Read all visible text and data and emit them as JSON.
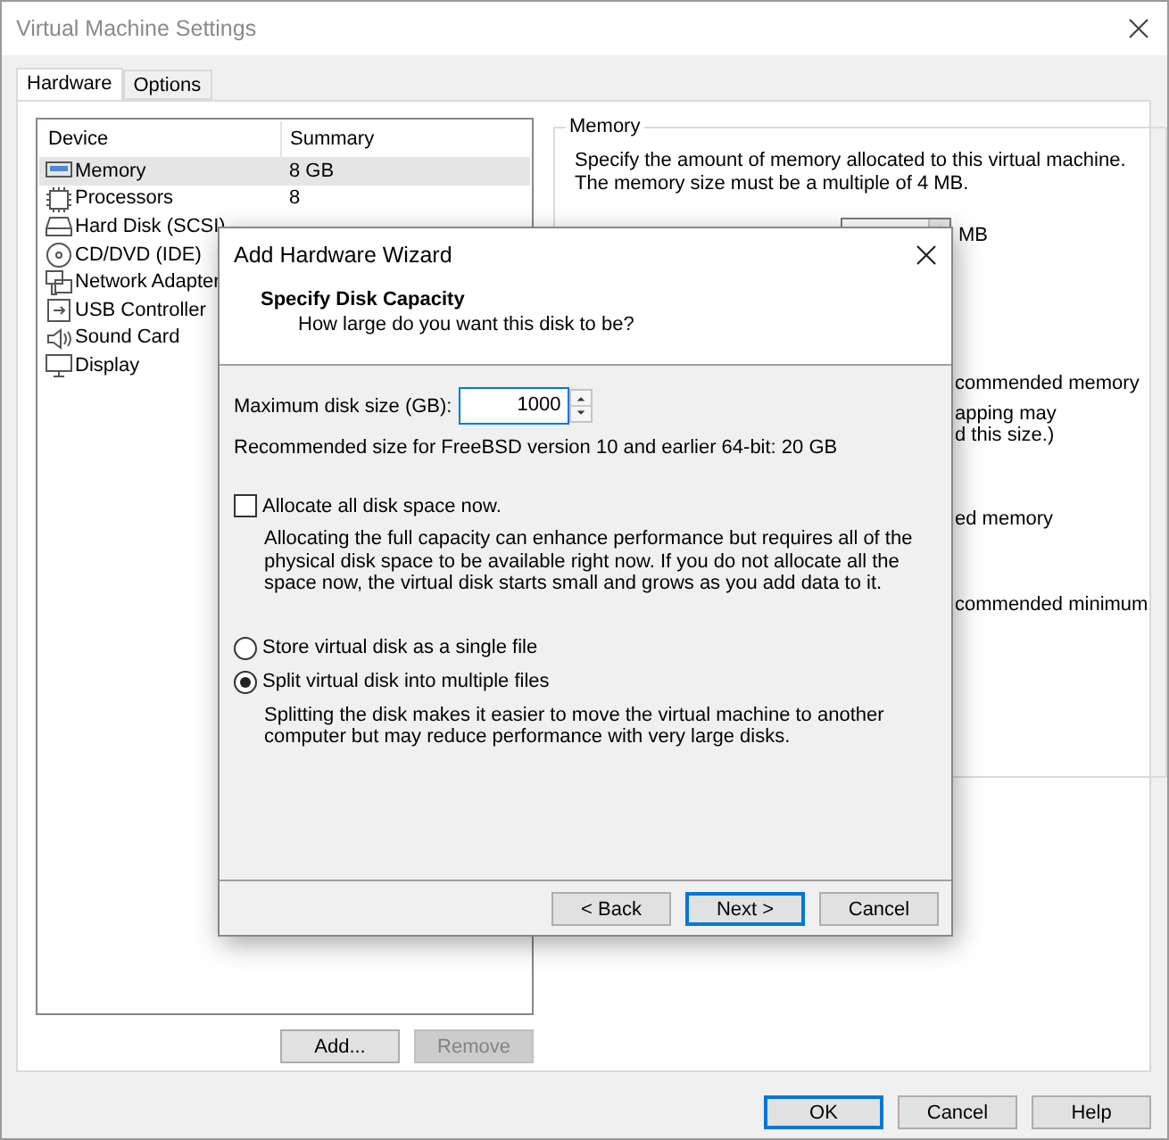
{
  "window": {
    "title": "Virtual Machine Settings"
  },
  "tabs": [
    {
      "label": "Hardware",
      "selected": true
    },
    {
      "label": "Options",
      "selected": false
    }
  ],
  "device_list": {
    "columns": [
      "Device",
      "Summary"
    ],
    "rows": [
      {
        "kind": "memory",
        "device": "Memory",
        "summary": "8 GB",
        "selected": true
      },
      {
        "kind": "processor",
        "device": "Processors",
        "summary": "8",
        "selected": false
      },
      {
        "kind": "disk",
        "device": "Hard Disk (SCSI)",
        "selected": false
      },
      {
        "kind": "cd",
        "device": "CD/DVD (IDE)",
        "selected": false
      },
      {
        "kind": "network",
        "device": "Network Adapter",
        "selected": false
      },
      {
        "kind": "usb",
        "device": "USB Controller",
        "selected": false
      },
      {
        "kind": "sound",
        "device": "Sound Card",
        "selected": false
      },
      {
        "kind": "display",
        "device": "Display",
        "selected": false
      }
    ]
  },
  "device_buttons": [
    {
      "label": "Add...",
      "disabled": false
    },
    {
      "label": "Remove",
      "disabled": true
    }
  ],
  "memory_panel": {
    "title": "Memory",
    "description": "Specify the amount of memory allocated to this virtual machine. The memory size must be a multiple of 4 MB.",
    "unit": "MB",
    "fragments": [
      "commended memory",
      "apping may",
      "d this size.)",
      "ed memory",
      "commended minimum"
    ]
  },
  "wizard": {
    "title": "Add Hardware Wizard",
    "heading": "Specify Disk Capacity",
    "subheading": "How large do you want this disk to be?",
    "size_label": "Maximum disk size (GB):",
    "size_value": "1000",
    "recommendation": "Recommended size for FreeBSD version 10 and earlier 64-bit: 20 GB",
    "allocate": {
      "label": "Allocate all disk space now.",
      "checked": false,
      "description": "Allocating the full capacity can enhance performance but requires all of the physical disk space to be available right now. If you do not allocate all the space now, the virtual disk starts small and grows as you add data to it."
    },
    "storage_options": [
      {
        "label": "Store virtual disk as a single file",
        "selected": false
      },
      {
        "label": "Split virtual disk into multiple files",
        "selected": true,
        "description": "Splitting the disk makes it easier to move the virtual machine to another computer but may reduce performance with very large disks."
      }
    ],
    "buttons": [
      {
        "label": "< Back",
        "default": false
      },
      {
        "label": "Next >",
        "default": true
      },
      {
        "label": "Cancel",
        "default": false
      }
    ]
  },
  "footer_buttons": [
    {
      "label": "OK",
      "default": true
    },
    {
      "label": "Cancel",
      "default": false
    },
    {
      "label": "Help",
      "default": false
    }
  ]
}
